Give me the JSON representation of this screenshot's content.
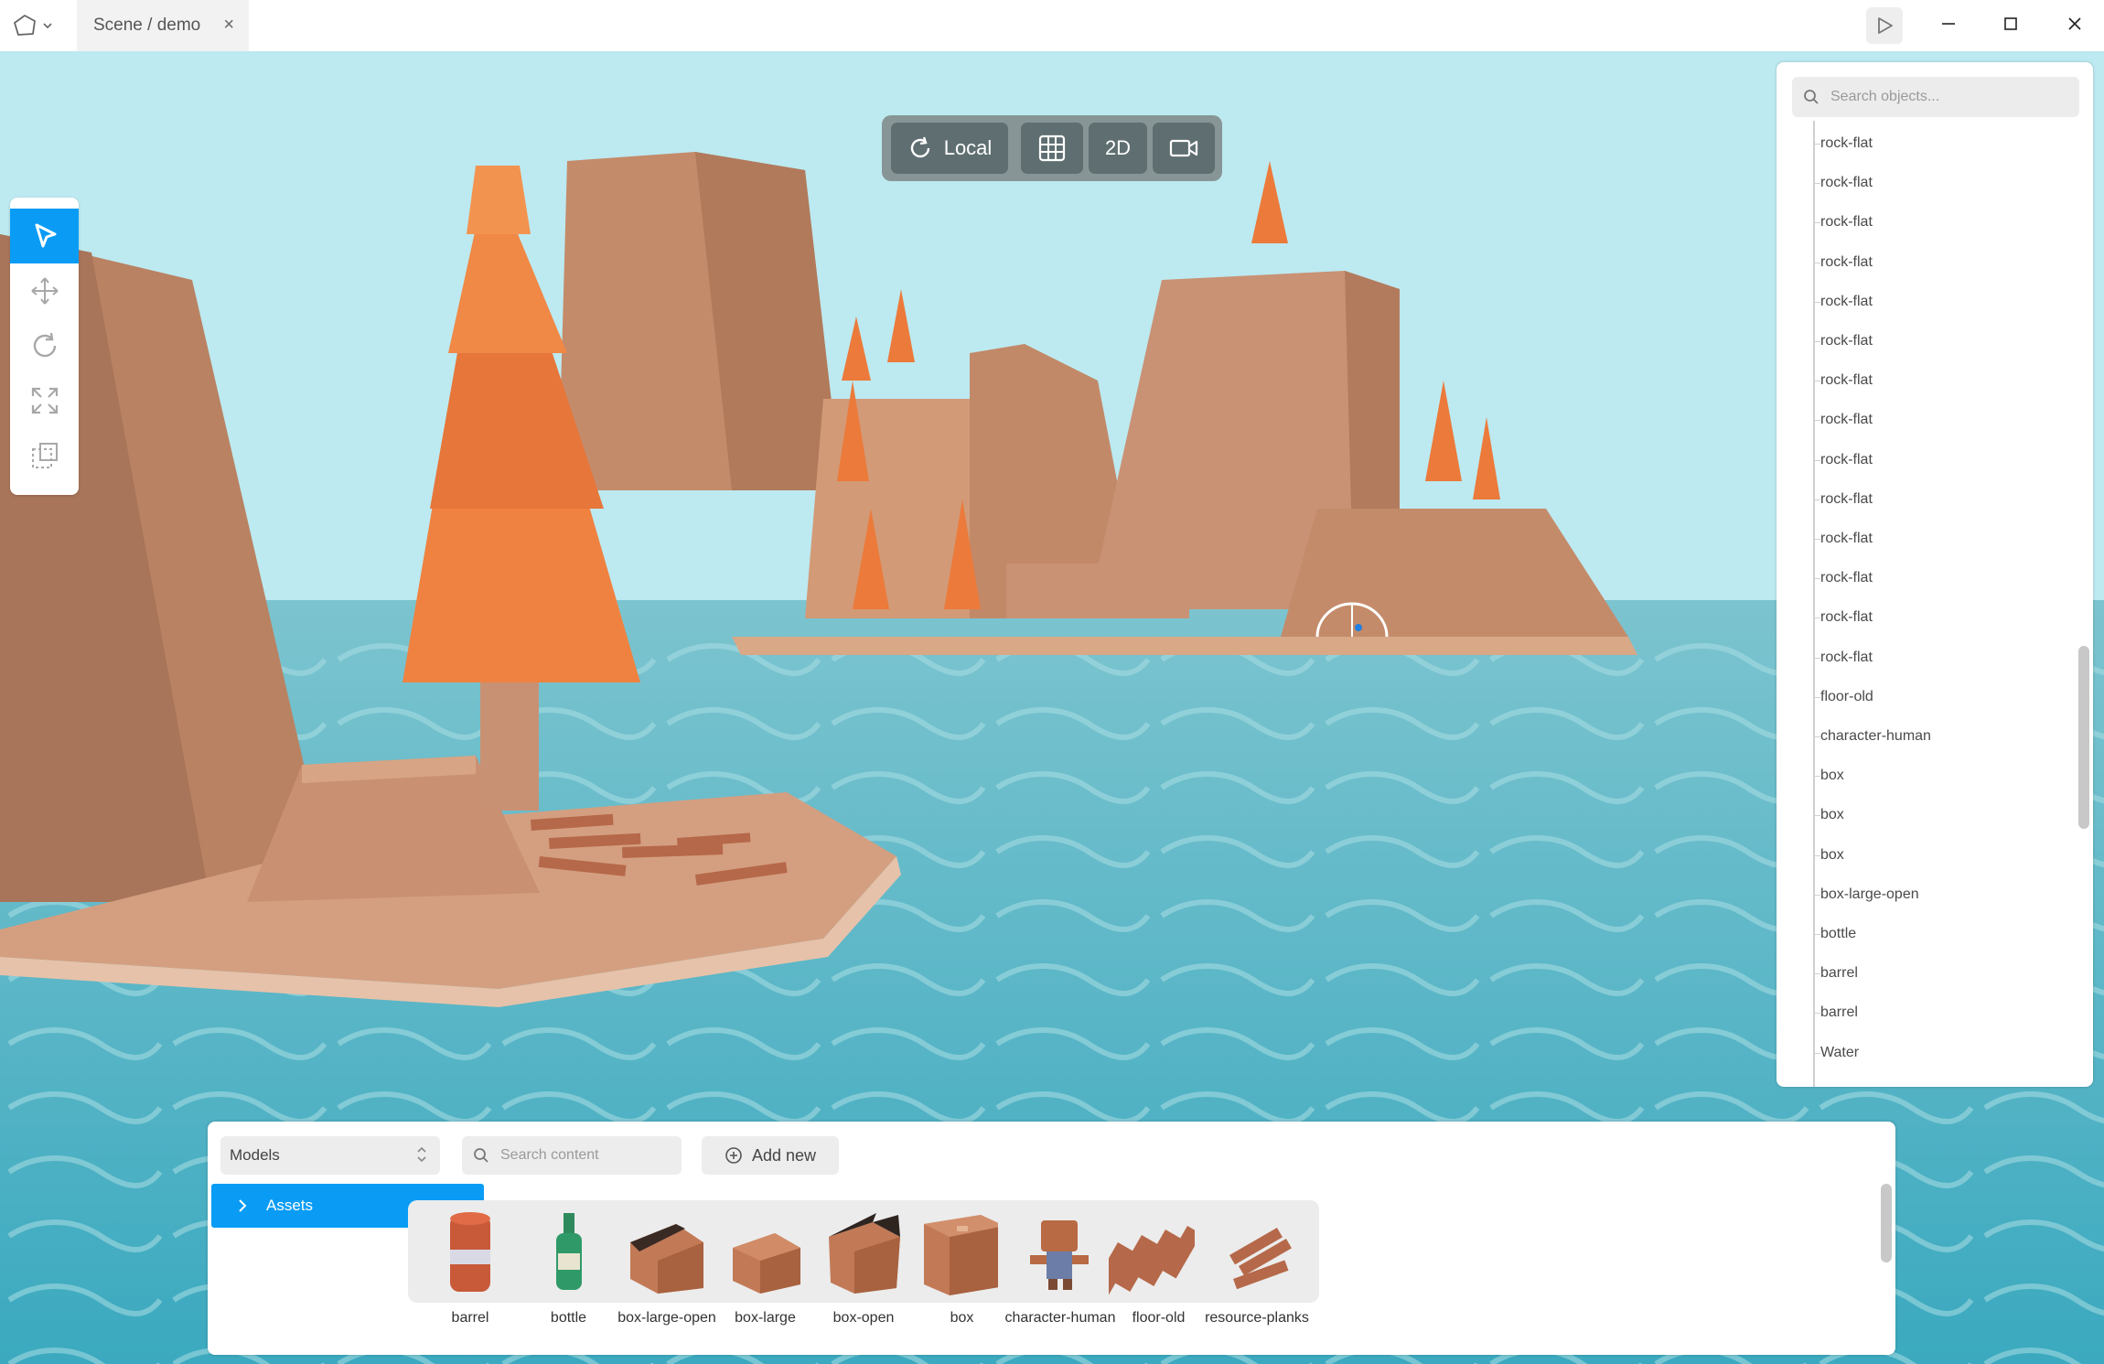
{
  "window": {
    "tab_title": "Scene / demo",
    "tab_close": "×"
  },
  "toolbar": {
    "space_label": "Local",
    "mode_2d": "2D"
  },
  "outliner": {
    "search_placeholder": "Search objects...",
    "items": [
      "rock-flat",
      "rock-flat",
      "rock-flat",
      "rock-flat",
      "rock-flat",
      "rock-flat",
      "rock-flat",
      "rock-flat",
      "rock-flat",
      "rock-flat",
      "rock-flat",
      "rock-flat",
      "rock-flat",
      "rock-flat",
      "floor-old",
      "character-human",
      "box",
      "box",
      "box",
      "box-large-open",
      "bottle",
      "barrel",
      "barrel",
      "Water"
    ]
  },
  "assets_panel": {
    "category_select": "Models",
    "search_placeholder": "Search content",
    "add_new_label": "Add new",
    "folder_label": "Assets",
    "items": [
      {
        "label": "barrel",
        "icon": "barrel-model-icon"
      },
      {
        "label": "bottle",
        "icon": "bottle-model-icon"
      },
      {
        "label": "box-large-open",
        "icon": "box-large-open-model-icon"
      },
      {
        "label": "box-large",
        "icon": "box-large-model-icon"
      },
      {
        "label": "box-open",
        "icon": "box-open-model-icon"
      },
      {
        "label": "box",
        "icon": "box-model-icon"
      },
      {
        "label": "character-human",
        "icon": "character-human-model-icon"
      },
      {
        "label": "floor-old",
        "icon": "floor-old-model-icon"
      },
      {
        "label": "resource-planks",
        "icon": "resource-planks-model-icon"
      }
    ]
  },
  "colors": {
    "accent": "#0a9cf5",
    "sky": "#bde9f0",
    "water": "#4fb4c6",
    "rock": "#c98f6c",
    "tree": "#ec7a3a",
    "toolbar_bg": "#879596",
    "toolbar_btn": "#5f6f71"
  }
}
